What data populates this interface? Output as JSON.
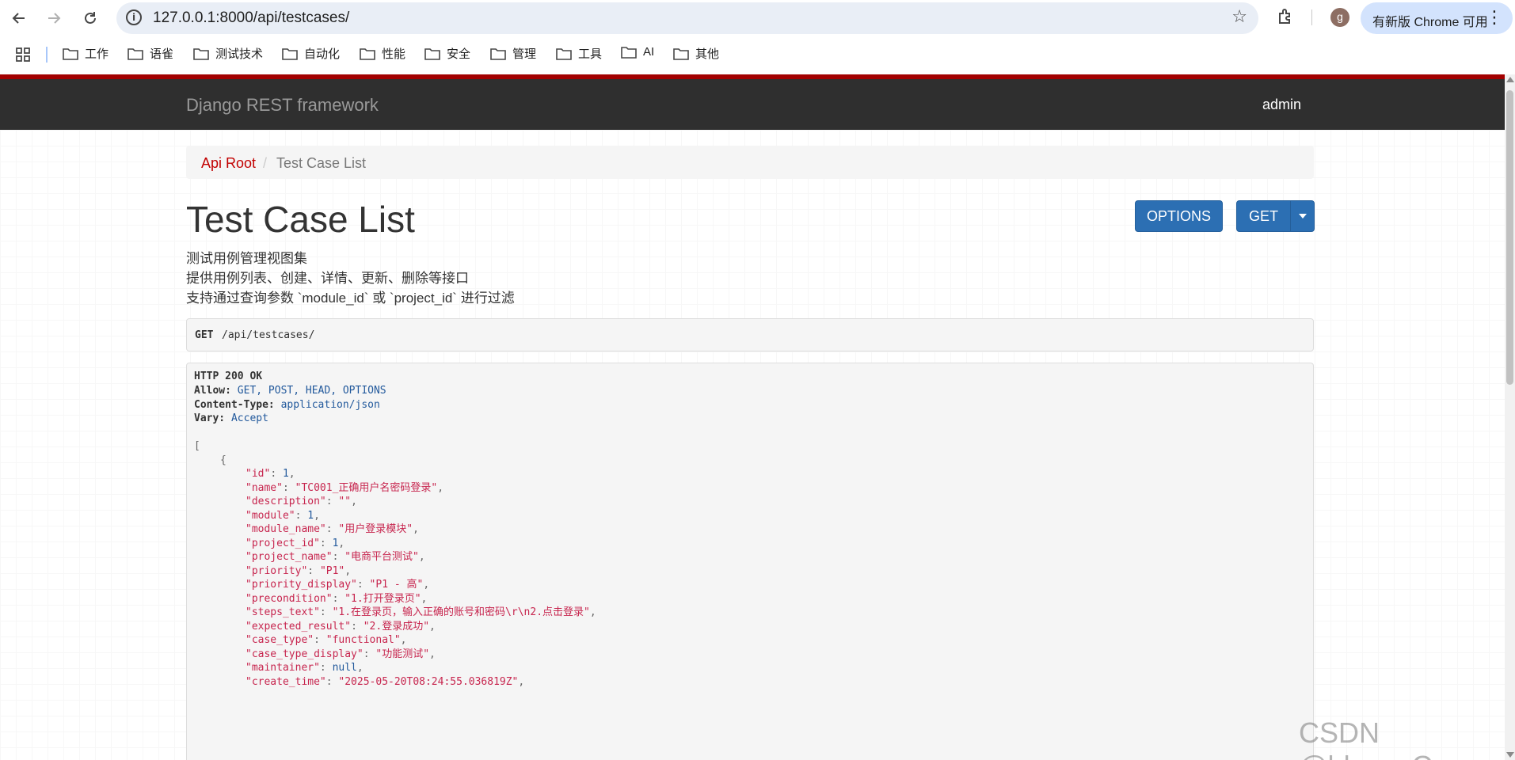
{
  "browser": {
    "url": "127.0.0.1:8000/api/testcases/",
    "profile_initial": "g",
    "update_label": "有新版 Chrome 可用",
    "bookmarks": [
      "工作",
      "语雀",
      "测试技术",
      "自动化",
      "性能",
      "安全",
      "管理",
      "工具",
      "AI",
      "其他"
    ]
  },
  "navbar": {
    "brand": "Django REST framework",
    "user": "admin"
  },
  "breadcrumb": {
    "root": "Api Root",
    "separator": "/",
    "current": "Test Case List"
  },
  "page": {
    "title": "Test Case List",
    "options_button": "OPTIONS",
    "get_button": "GET",
    "description": [
      "测试用例管理视图集",
      "提供用例列表、创建、详情、更新、删除等接口",
      "支持通过查询参数 `module_id` 或 `project_id` 进行过滤"
    ]
  },
  "request": {
    "method": "GET",
    "path": "/api/testcases/"
  },
  "response": {
    "status": "HTTP 200 OK",
    "headers": [
      {
        "key": "Allow:",
        "value": "GET, POST, HEAD, OPTIONS"
      },
      {
        "key": "Content-Type:",
        "value": "application/json"
      },
      {
        "key": "Vary:",
        "value": "Accept"
      }
    ],
    "open_bracket": "[",
    "open_brace": "{",
    "fields": [
      {
        "key": "\"id\"",
        "value": "1",
        "type": "num"
      },
      {
        "key": "\"name\"",
        "value": "\"TC001_正确用户名密码登录\"",
        "type": "str"
      },
      {
        "key": "\"description\"",
        "value": "\"\"",
        "type": "str"
      },
      {
        "key": "\"module\"",
        "value": "1",
        "type": "num"
      },
      {
        "key": "\"module_name\"",
        "value": "\"用户登录模块\"",
        "type": "str"
      },
      {
        "key": "\"project_id\"",
        "value": "1",
        "type": "num"
      },
      {
        "key": "\"project_name\"",
        "value": "\"电商平台测试\"",
        "type": "str"
      },
      {
        "key": "\"priority\"",
        "value": "\"P1\"",
        "type": "str"
      },
      {
        "key": "\"priority_display\"",
        "value": "\"P1 - 高\"",
        "type": "str"
      },
      {
        "key": "\"precondition\"",
        "value": "\"1.打开登录页\"",
        "type": "str"
      },
      {
        "key": "\"steps_text\"",
        "value": "\"1.在登录页，输入正确的账号和密码\\r\\n2.点击登录\"",
        "type": "str"
      },
      {
        "key": "\"expected_result\"",
        "value": "\"2.登录成功\"",
        "type": "str"
      },
      {
        "key": "\"case_type\"",
        "value": "\"functional\"",
        "type": "str"
      },
      {
        "key": "\"case_type_display\"",
        "value": "\"功能测试\"",
        "type": "str"
      },
      {
        "key": "\"maintainer\"",
        "value": "null",
        "type": "null"
      },
      {
        "key": "\"create_time\"",
        "value": "\"2025-05-20T08:24:55.036819Z\"",
        "type": "str"
      }
    ]
  },
  "watermark": "CSDN @blues_C",
  "colors": {
    "brand_red": "#a30000",
    "navbar_bg": "#2f2f2f",
    "button_blue": "#2c6fb3",
    "json_string": "#c7254e",
    "json_number": "#22599c"
  }
}
